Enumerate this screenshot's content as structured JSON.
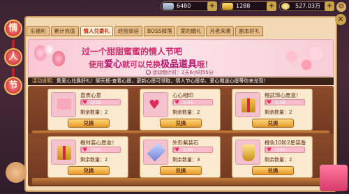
{
  "topbar": {
    "coin_value": "6480",
    "gold_value": "1288",
    "silver_value": "527.03万",
    "plus_label": "+"
  },
  "side_banner": [
    "情",
    "人",
    "节"
  ],
  "tabs": [
    {
      "label": "乐福利",
      "active": false
    },
    {
      "label": "累计充值",
      "active": false
    },
    {
      "label": "情人兑豪礼",
      "active": true
    },
    {
      "label": "经验双倍",
      "active": false
    },
    {
      "label": "BOSS掉落",
      "active": false
    },
    {
      "label": "爱的婚礼",
      "active": false
    },
    {
      "label": "月老来袭",
      "active": false
    },
    {
      "label": "副本好礼",
      "active": false
    }
  ],
  "banner": {
    "line1": "过一个甜甜蜜蜜的情人节吧",
    "line2_prefix": "使用",
    "line2_hl1": "爱心",
    "line2_mid": "就可以兑换",
    "line2_hl2": "极品道具",
    "line2_suffix": "哦！",
    "countdown": "活动倒计时：2天6小时55分"
  },
  "description": {
    "label": "活动说明：",
    "text": "集爱心兑换好礼！聊天框-查看心愿，更新心愿可领取，情人节心愿单、爱心赠送心愿等你来兑现！"
  },
  "items": [
    {
      "name": "直表心意",
      "ratio": "1/38",
      "fill": 0.03,
      "remain_label": "剩余数量：",
      "remain": "2",
      "button": "兑换"
    },
    {
      "name": "心心相印",
      "ratio": "1/45",
      "fill": 0.02,
      "remain_label": "剩余数量：",
      "remain": "2",
      "button": "兑换"
    },
    {
      "name": "橙武饰心愿盒！",
      "ratio": "1/38",
      "fill": 0.03,
      "remain_label": "剩余数量：",
      "remain": "2",
      "button": "兑换"
    },
    {
      "name": "橙时装心愿盒！",
      "ratio": "1/90",
      "fill": 0.01,
      "remain_label": "剩余数量：",
      "remain": "2",
      "button": "兑换"
    },
    {
      "name": "外形紫装石",
      "ratio": "1/30",
      "fill": 0.03,
      "remain_label": "剩余数量：",
      "remain": "3",
      "button": "兑换"
    },
    {
      "name": "橙色10阶2星装备",
      "ratio": "1/90",
      "fill": 0.01,
      "remain_label": "剩余数量：",
      "remain": "2",
      "button": "兑换"
    }
  ],
  "icons": {
    "settings": "gear-icon",
    "close": "close-icon",
    "heart": "heart-icon"
  }
}
